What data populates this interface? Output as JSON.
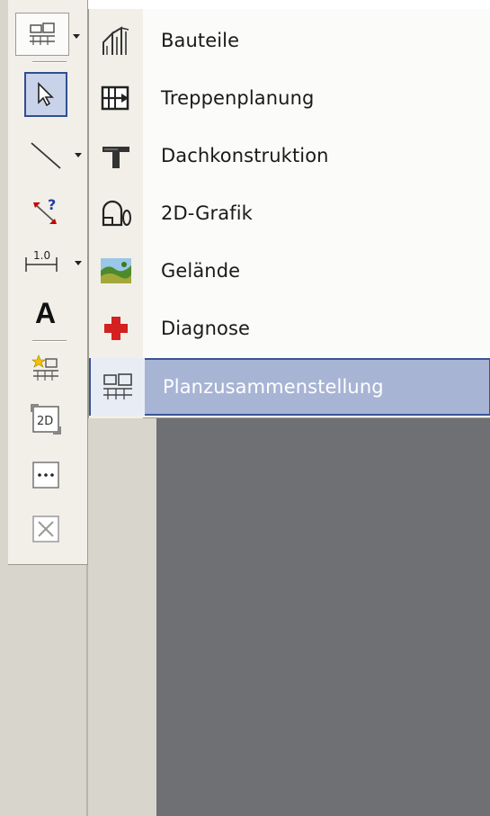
{
  "toolbar": {
    "tools": [
      {
        "name": "plan-layout-tool",
        "icon": "plan-layout-icon",
        "has_dropdown": true
      },
      {
        "name": "select-tool",
        "icon": "arrow-pointer-icon",
        "selected": true
      },
      {
        "name": "line-tool",
        "icon": "diagonal-line-icon",
        "has_dropdown": true
      },
      {
        "name": "help-tool",
        "icon": "measure-help-icon"
      },
      {
        "name": "dimension-tool",
        "icon": "dimension-icon",
        "has_dropdown": true,
        "text": "1.0"
      },
      {
        "name": "text-tool",
        "icon": "text-a-icon",
        "text": "A"
      },
      {
        "name": "plan-new-tool",
        "icon": "plan-star-icon"
      },
      {
        "name": "view-2d-tool",
        "icon": "view-2d-icon",
        "text": "2D"
      },
      {
        "name": "more-tool",
        "icon": "ellipsis-icon",
        "text": "..."
      },
      {
        "name": "disabled-tool",
        "icon": "cross-box-icon"
      }
    ]
  },
  "menu": {
    "items": [
      {
        "label": "Bauteile",
        "icon": "building-component-icon"
      },
      {
        "label": "Treppenplanung",
        "icon": "stair-icon"
      },
      {
        "label": "Dachkonstruktion",
        "icon": "roof-icon"
      },
      {
        "label": "2D-Grafik",
        "icon": "2d-graphic-icon"
      },
      {
        "label": "Gelände",
        "icon": "terrain-icon"
      },
      {
        "label": "Diagnose",
        "icon": "red-cross-icon"
      },
      {
        "label": "Planzusammenstellung",
        "icon": "plan-layout-icon",
        "highlighted": true
      }
    ]
  },
  "colors": {
    "highlight_bg": "#a8b4d4",
    "highlight_border": "#3a5494",
    "dark_area": "#6f7074",
    "toolbar_bg": "#f1efe8",
    "diagnose_red": "#d42020"
  }
}
